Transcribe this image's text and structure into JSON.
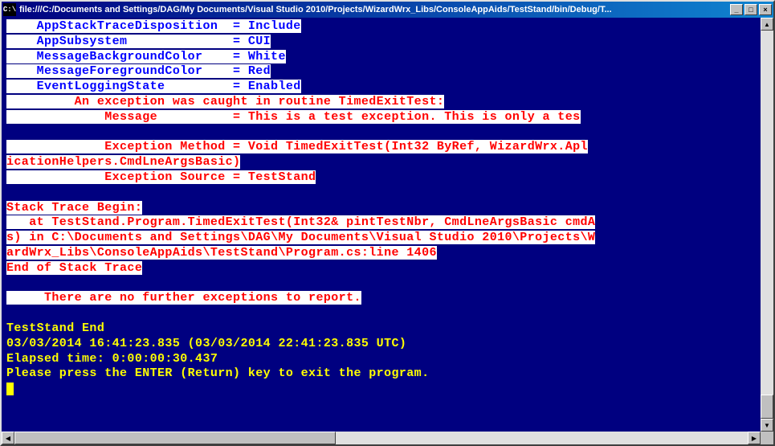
{
  "window": {
    "icon_text": "C:\\",
    "title": "file:///C:/Documents and Settings/DAG/My Documents/Visual Studio 2010/Projects/WizardWrx_Libs/ConsoleAppAids/TestStand/bin/Debug/T...",
    "buttons": {
      "min": "_",
      "max": "□",
      "close": "×"
    }
  },
  "config_lines": [
    "    AppStackTraceDisposition  = Include",
    "    AppSubsystem              = CUI",
    "    MessageBackgroundColor    = White",
    "    MessageForegroundColor    = Red",
    "    EventLoggingState         = Enabled"
  ],
  "error_lines": [
    "         An exception was caught in routine TimedExitTest:",
    "             Message          = This is a test exception. This is only a tes",
    "",
    "             Exception Method = Void TimedExitTest(Int32 ByRef, WizardWrx.Apl",
    "icationHelpers.CmdLneArgsBasic)",
    "             Exception Source = TestStand",
    "",
    "Stack Trace Begin:",
    "   at TestStand.Program.TimedExitTest(Int32& pintTestNbr, CmdLneArgsBasic cmdA",
    "s) in C:\\Documents and Settings\\DAG\\My Documents\\Visual Studio 2010\\Projects\\W",
    "ardWrx_Libs\\ConsoleAppAids\\TestStand\\Program.cs:line 1406",
    "End of Stack Trace",
    "",
    "     There are no further exceptions to report."
  ],
  "final_lines": [
    "",
    "TestStand End",
    "03/03/2014 16:41:23.835 (03/03/2014 22:41:23.835 UTC)",
    "Elapsed time: 0:00:00:30.437",
    "Please press the ENTER (Return) key to exit the program."
  ]
}
